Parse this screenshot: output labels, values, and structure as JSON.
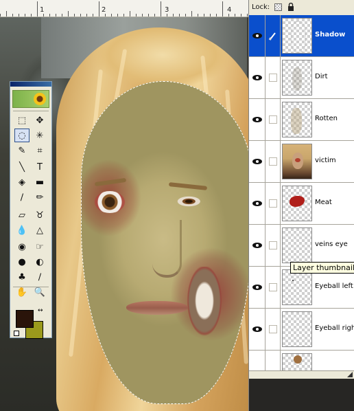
{
  "ruler": {
    "numbers": [
      "1",
      "2",
      "3",
      "4"
    ]
  },
  "toolbox": {
    "tools": [
      {
        "name": "marquee-icon",
        "glyph": "⬚"
      },
      {
        "name": "move-icon",
        "glyph": "✥"
      },
      {
        "name": "lasso-icon",
        "glyph": "◌"
      },
      {
        "name": "magic-wand-icon",
        "glyph": "✳"
      },
      {
        "name": "brush-slice-icon",
        "glyph": "✎"
      },
      {
        "name": "crop-icon",
        "glyph": "⌗"
      },
      {
        "name": "line-icon",
        "glyph": "╲"
      },
      {
        "name": "type-icon",
        "glyph": "T"
      },
      {
        "name": "paint-bucket-icon",
        "glyph": "◈"
      },
      {
        "name": "gradient-icon",
        "glyph": "▬"
      },
      {
        "name": "brush-icon",
        "glyph": "∕"
      },
      {
        "name": "pencil-icon",
        "glyph": "✏"
      },
      {
        "name": "eraser-icon",
        "glyph": "▱"
      },
      {
        "name": "clone-stamp-icon",
        "glyph": "♉"
      },
      {
        "name": "blur-icon",
        "glyph": "💧"
      },
      {
        "name": "sharpen-icon",
        "glyph": "△"
      },
      {
        "name": "smudge-icon",
        "glyph": "◉"
      },
      {
        "name": "burn-icon",
        "glyph": "☞"
      },
      {
        "name": "dodge-icon",
        "glyph": "●"
      },
      {
        "name": "sponge-icon",
        "glyph": "◐"
      },
      {
        "name": "stamp-icon",
        "glyph": "♣"
      },
      {
        "name": "eyedropper-icon",
        "glyph": "∕"
      },
      {
        "name": "hand-icon",
        "glyph": "✋"
      },
      {
        "name": "zoom-icon",
        "glyph": "🔍"
      }
    ],
    "colors": {
      "foreground": "#2a140a",
      "background": "#9b9a1c"
    }
  },
  "lockbar": {
    "label": "Lock:"
  },
  "layers": [
    {
      "name": "Shadow",
      "selected": true,
      "thumb": "shadow"
    },
    {
      "name": "Dirt",
      "selected": false,
      "thumb": "dirt"
    },
    {
      "name": "Rotten",
      "selected": false,
      "thumb": "rotten"
    },
    {
      "name": "victim",
      "selected": false,
      "thumb": "victim"
    },
    {
      "name": "Meat",
      "selected": false,
      "thumb": "meat"
    },
    {
      "name": "veins eye",
      "selected": false,
      "thumb": "veins"
    },
    {
      "name": "Eyeball left",
      "selected": false,
      "thumb": "eyeleft"
    },
    {
      "name": "Eyeball right",
      "selected": false,
      "thumb": "eyeright"
    }
  ],
  "tooltip": "Layer thumbnail",
  "colors": {
    "accent": "#0a4fcc",
    "panel": "#d4d0c8",
    "tooltip_bg": "#ffffe1"
  }
}
